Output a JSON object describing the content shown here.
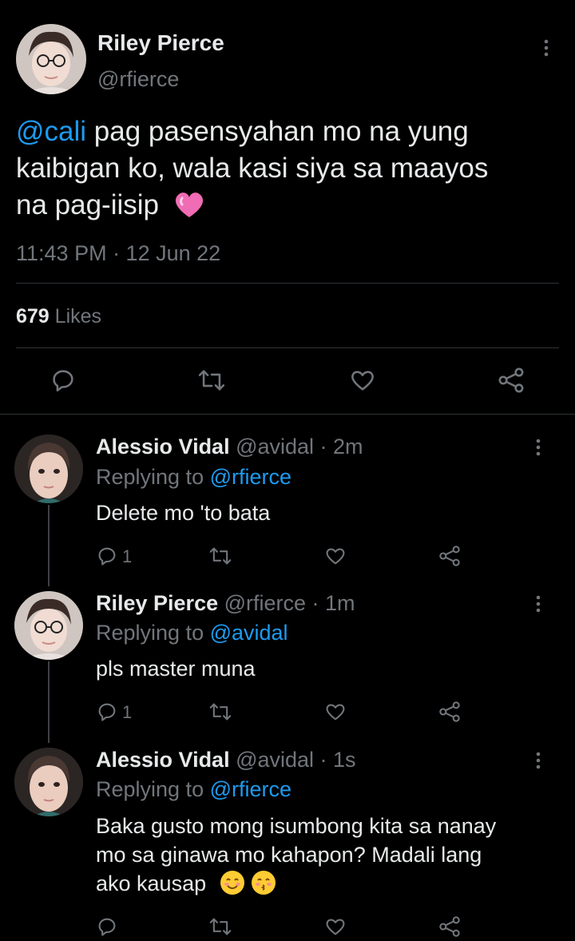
{
  "main_tweet": {
    "display_name": "Riley Pierce",
    "handle": "@rfierce",
    "mention": "@cali",
    "text_line1": " pag pasensyahan mo na yung",
    "text_line2": "kaibigan ko, wala kasi siya sa maayos",
    "text_line3": "na pag-iisip",
    "emoji": "heart-emoji",
    "timestamp": "11:43 PM · 12 Jun 22",
    "likes_count": "679",
    "likes_label": " Likes",
    "actions": [
      "reply-icon",
      "retweet-icon",
      "like-icon",
      "share-icon"
    ]
  },
  "replies": [
    {
      "display_name": "Alessio Vidal",
      "handle_time": "@avidal · 2m",
      "replying_prefix": "Replying to ",
      "replying_to": "@rfierce",
      "text": "Delete mo 'to bata",
      "reply_count": "1"
    },
    {
      "display_name": "Riley Pierce",
      "handle_time": "@rfierce · 1m",
      "replying_prefix": "Replying to ",
      "replying_to": "@avidal",
      "text": "pls master muna",
      "reply_count": "1"
    },
    {
      "display_name": "Alessio Vidal",
      "handle_time": "@avidal · 1s",
      "replying_prefix": "Replying to ",
      "replying_to": "@rfierce",
      "text_line1": "Baka gusto mong isumbong kita sa nanay",
      "text_line2": "mo sa ginawa mo kahapon? Madali lang",
      "text_line3": "ako kausap",
      "emojis": [
        "smiling-face-emoji",
        "kissing-face-emoji"
      ]
    }
  ],
  "colors": {
    "background": "#000000",
    "text": "#e7e9ea",
    "muted": "#71767b",
    "link": "#1d9bf0",
    "divider": "#2f3336"
  }
}
